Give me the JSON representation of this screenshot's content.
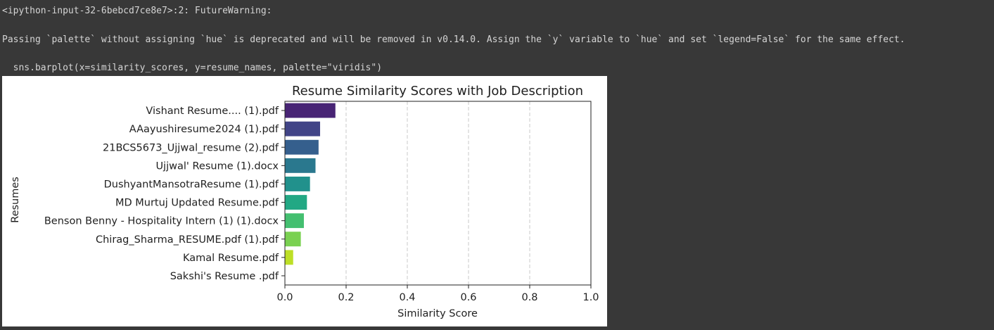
{
  "output": {
    "warning_header": "<ipython-input-32-6bebcd7ce8e7>:2: FutureWarning:",
    "warning_message": "Passing `palette` without assigning `hue` is deprecated and will be removed in v0.14.0. Assign the `y` variable to `hue` and set `legend=False` for the same effect.",
    "code_line": "  sns.barplot(x=similarity_scores, y=resume_names, palette=\"viridis\")"
  },
  "chart_data": {
    "type": "bar",
    "orientation": "horizontal",
    "title": "Resume Similarity Scores with Job Description",
    "xlabel": "Similarity Score",
    "ylabel": "Resumes",
    "xlim": [
      0,
      1.0
    ],
    "xticks": [
      "0.0",
      "0.2",
      "0.4",
      "0.6",
      "0.8",
      "1.0"
    ],
    "grid": "x-dashed",
    "palette": "viridis",
    "categories": [
      "Vishant Resume.... (1).pdf",
      "AAayushiresume2024 (1).pdf",
      "21BCS5673_Ujjwal_resume (2).pdf",
      "Ujjwal' Resume (1).docx",
      "DushyantMansotraResume (1).pdf",
      "MD Murtuj Updated Resume.pdf",
      "Benson Benny - Hospitality Intern (1) (1).docx",
      "Chirag_Sharma_RESUME.pdf (1).pdf",
      "Kamal Resume.pdf",
      "Sakshi's Resume .pdf"
    ],
    "values": [
      0.165,
      0.115,
      0.11,
      0.1,
      0.082,
      0.072,
      0.062,
      0.052,
      0.027,
      0.0
    ],
    "colors": [
      "#482475",
      "#414487",
      "#355f8d",
      "#2a788e",
      "#21918c",
      "#22a884",
      "#44bf70",
      "#7ad151",
      "#bddf26",
      "#fde725"
    ]
  }
}
